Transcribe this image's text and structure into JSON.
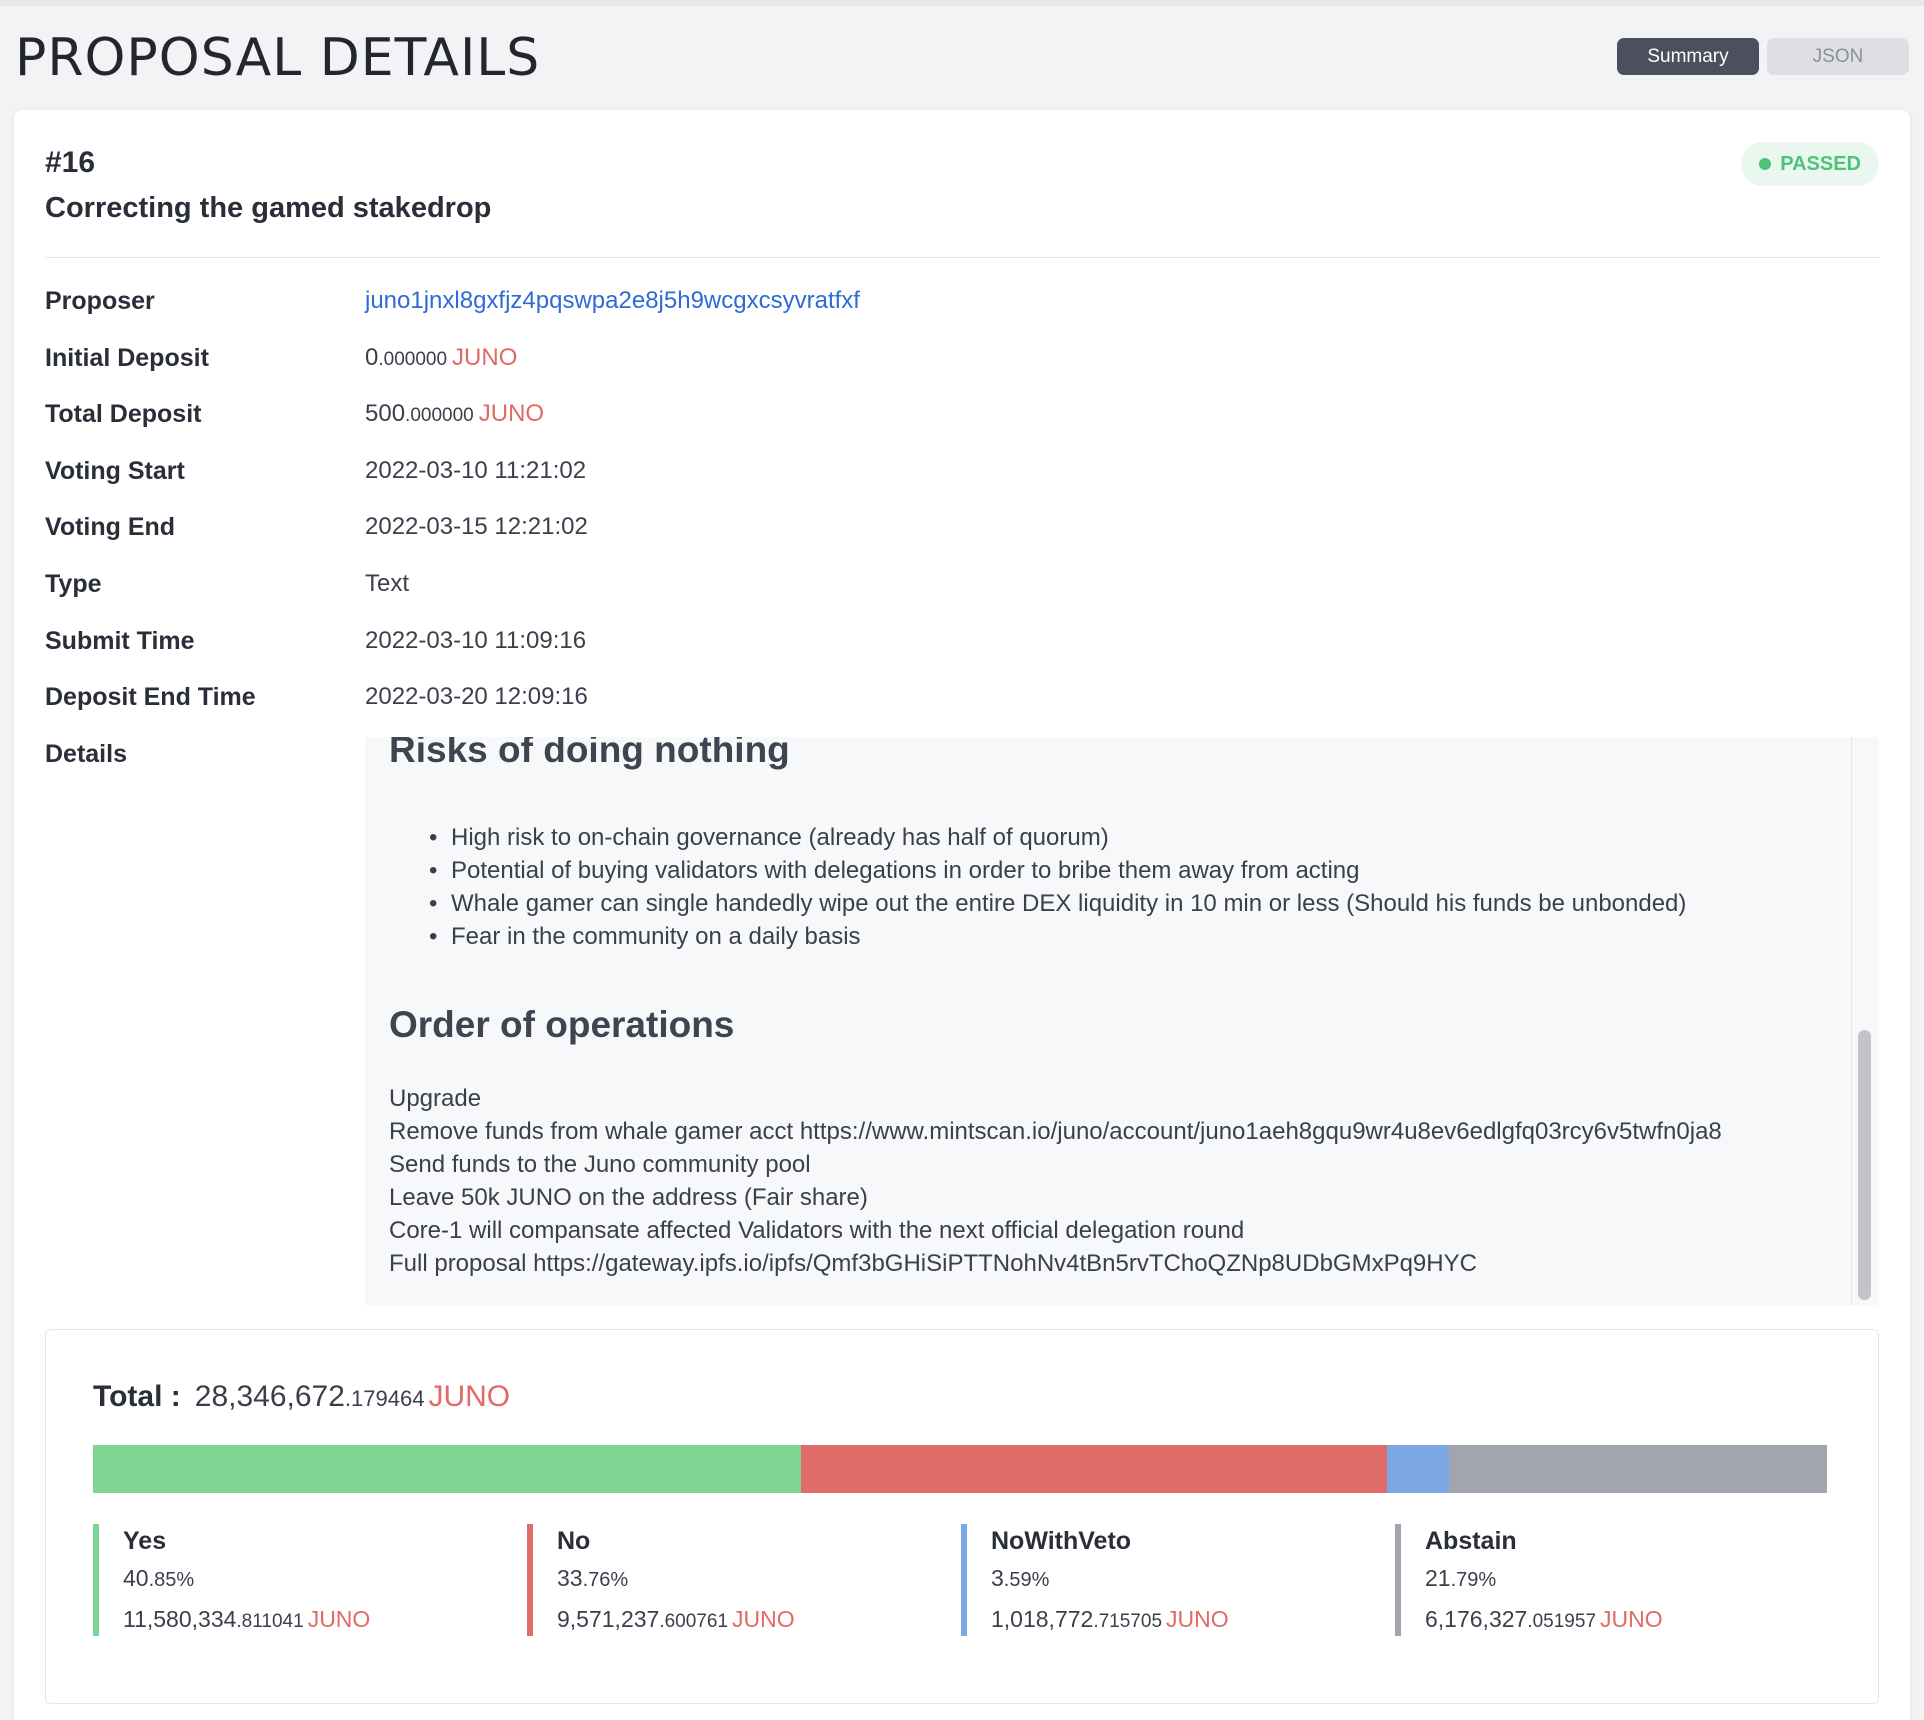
{
  "page": {
    "title": "PROPOSAL DETAILS"
  },
  "view_toggle": {
    "summary_label": "Summary",
    "json_label": "JSON"
  },
  "proposal": {
    "id": "#16",
    "title": "Correcting the gamed stakedrop",
    "status": "PASSED",
    "fields": {
      "proposer": {
        "label": "Proposer",
        "value": "juno1jnxl8gxfjz4pqswpa2e8j5h9wcgxcsyvratfxf"
      },
      "initial_deposit": {
        "label": "Initial Deposit",
        "int": "0",
        "frac": ".000000",
        "denom": "JUNO"
      },
      "total_deposit": {
        "label": "Total Deposit",
        "int": "500",
        "frac": ".000000",
        "denom": "JUNO"
      },
      "voting_start": {
        "label": "Voting Start",
        "value": "2022-03-10 11:21:02"
      },
      "voting_end": {
        "label": "Voting End",
        "value": "2022-03-15 12:21:02"
      },
      "type": {
        "label": "Type",
        "value": "Text"
      },
      "submit_time": {
        "label": "Submit Time",
        "value": "2022-03-10 11:09:16"
      },
      "deposit_end_time": {
        "label": "Deposit End Time",
        "value": "2022-03-20 12:09:16"
      },
      "details": {
        "label": "Details"
      }
    },
    "details_content": {
      "heading1": "Risks of doing nothing",
      "risks": [
        "High risk to on-chain governance (already has half of quorum)",
        "Potential of buying validators with delegations in order to bribe them away from acting",
        "Whale gamer can single handedly wipe out the entire DEX liquidity in 10 min or less (Should his funds be unbonded)",
        "Fear in the community on a daily basis"
      ],
      "heading2": "Order of operations",
      "operations": [
        "Upgrade",
        "Remove funds from whale gamer acct https://www.mintscan.io/juno/account/juno1aeh8gqu9wr4u8ev6edlgfq03rcy6v5twfn0ja8",
        "Send funds to the Juno community pool",
        "Leave 50k JUNO on the address (Fair share)",
        "Core-1 will compansate affected Validators with the next official delegation round",
        "Full proposal https://gateway.ipfs.io/ipfs/Qmf3bGHiSiPTTNohNv4tBn5rvTChoQZNp8UDbGMxPq9HYC"
      ]
    }
  },
  "tally": {
    "total_label": "Total :",
    "total_int": "28,346,672",
    "total_frac": ".179464",
    "denom": "JUNO",
    "options": [
      {
        "label": "Yes",
        "pct_int": "40",
        "pct_frac": ".85%",
        "percent": 40.85,
        "amt_int": "11,580,334",
        "amt_frac": ".811041",
        "color": "#7fd491"
      },
      {
        "label": "No",
        "pct_int": "33",
        "pct_frac": ".76%",
        "percent": 33.76,
        "amt_int": "9,571,237",
        "amt_frac": ".600761",
        "color": "#e06c69"
      },
      {
        "label": "NoWithVeto",
        "pct_int": "3",
        "pct_frac": ".59%",
        "percent": 3.59,
        "amt_int": "1,018,772",
        "amt_frac": ".715705",
        "color": "#7ba7e2"
      },
      {
        "label": "Abstain",
        "pct_int": "21",
        "pct_frac": ".79%",
        "percent": 21.79,
        "amt_int": "6,176,327",
        "amt_frac": ".051957",
        "color": "#a2a5ad"
      }
    ]
  }
}
